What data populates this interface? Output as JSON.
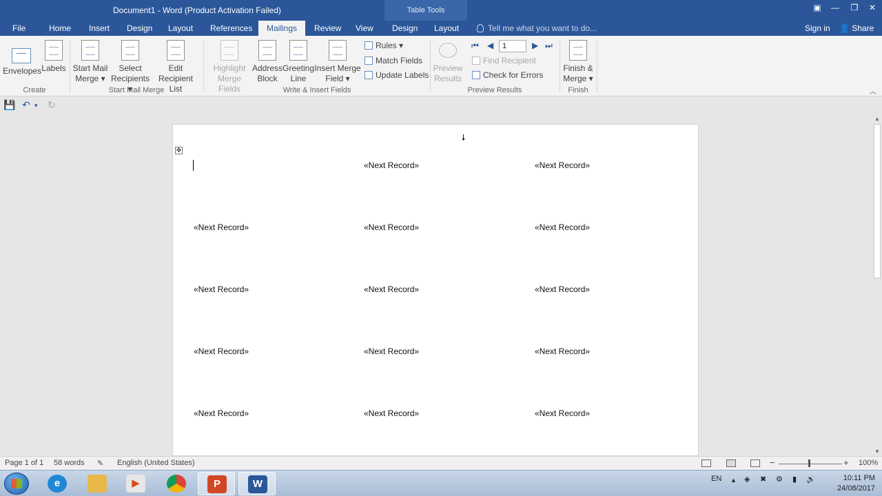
{
  "window": {
    "title": "Document1 - Word (Product Activation Failed)",
    "contextual_tab_group": "Table Tools"
  },
  "tabs": [
    {
      "label": "File"
    },
    {
      "label": "Home"
    },
    {
      "label": "Insert"
    },
    {
      "label": "Design"
    },
    {
      "label": "Layout"
    },
    {
      "label": "References"
    },
    {
      "label": "Mailings",
      "active": true
    },
    {
      "label": "Review"
    },
    {
      "label": "View"
    },
    {
      "label": "Design"
    },
    {
      "label": "Layout"
    }
  ],
  "tell_me": "Tell me what you want to do...",
  "account": {
    "sign_in": "Sign in",
    "share": "Share"
  },
  "ribbon": {
    "create": {
      "group": "Create",
      "envelopes": "Envelopes",
      "labels": "Labels"
    },
    "start_mail_merge": {
      "group": "Start Mail Merge",
      "start_line1": "Start Mail",
      "start_line2": "Merge",
      "select_line1": "Select",
      "select_line2": "Recipients",
      "edit_line1": "Edit",
      "edit_line2": "Recipient List"
    },
    "write_insert": {
      "group": "Write & Insert Fields",
      "highlight_line1": "Highlight",
      "highlight_line2": "Merge Fields",
      "address_line1": "Address",
      "address_line2": "Block",
      "greeting_line1": "Greeting",
      "greeting_line2": "Line",
      "insert_line1": "Insert Merge",
      "insert_line2": "Field",
      "rules": "Rules",
      "match_fields": "Match Fields",
      "update_labels": "Update Labels"
    },
    "preview": {
      "group": "Preview Results",
      "preview_line1": "Preview",
      "preview_line2": "Results",
      "record_number": "1",
      "find_recipient": "Find Recipient",
      "check_errors": "Check for Errors"
    },
    "finish": {
      "group": "Finish",
      "finish_line1": "Finish &",
      "finish_line2": "Merge"
    }
  },
  "document": {
    "rows": [
      [
        "",
        "«Next Record»",
        "«Next Record»"
      ],
      [
        "«Next Record»",
        "«Next Record»",
        "«Next Record»"
      ],
      [
        "«Next Record»",
        "«Next Record»",
        "«Next Record»"
      ],
      [
        "«Next Record»",
        "«Next Record»",
        "«Next Record»"
      ],
      [
        "«Next Record»",
        "«Next Record»",
        "«Next Record»"
      ]
    ]
  },
  "status": {
    "page": "Page 1 of 1",
    "words": "58 words",
    "language": "English (United States)",
    "zoom": "100%"
  },
  "taskbar": {
    "language": "EN",
    "time": "10:11 PM",
    "date": "24/08/2017"
  }
}
